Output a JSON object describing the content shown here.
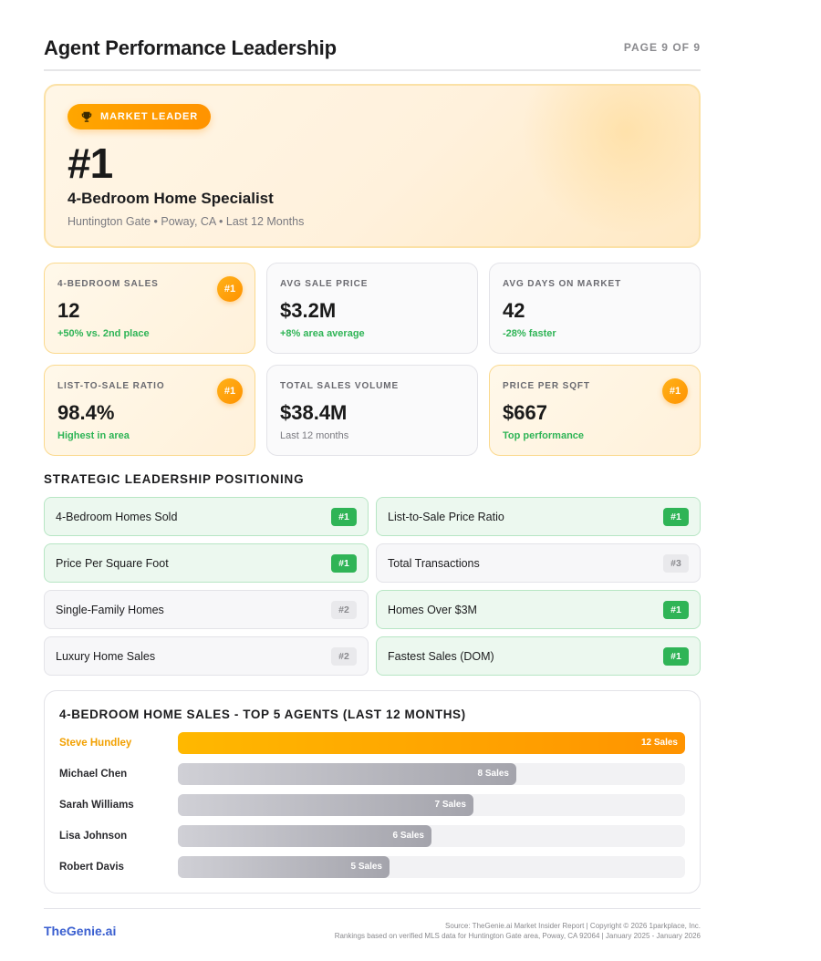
{
  "header": {
    "title": "Agent Performance Leadership",
    "page_label": "PAGE 9 OF 9"
  },
  "hero": {
    "badge_label": "MARKET LEADER",
    "badge_icon": "trophy-icon",
    "rank": "#1",
    "specialty": "4-Bedroom Home Specialist",
    "location": "Huntington Gate • Poway, CA • Last 12 Months"
  },
  "stats": [
    {
      "label": "4-BEDROOM SALES",
      "value": "12",
      "sub": "+50% vs. 2nd place",
      "badge": "#1"
    },
    {
      "label": "AVG SALE PRICE",
      "value": "$3.2M",
      "sub": "+8% area average",
      "badge": ""
    },
    {
      "label": "AVG DAYS ON MARKET",
      "value": "42",
      "sub": "-28% faster",
      "badge": ""
    },
    {
      "label": "LIST-TO-SALE RATIO",
      "value": "98.4%",
      "sub": "Highest in area",
      "badge": "#1"
    },
    {
      "label": "TOTAL SALES VOLUME",
      "value": "$38.4M",
      "sub": "Last 12 months",
      "badge": ""
    },
    {
      "label": "PRICE PER SQFT",
      "value": "$667",
      "sub": "Top performance",
      "badge": "#1"
    }
  ],
  "strategic": {
    "title": "STRATEGIC LEADERSHIP POSITIONING",
    "items": [
      {
        "label": "4-Bedroom Homes Sold",
        "rank": "#1"
      },
      {
        "label": "List-to-Sale Price Ratio",
        "rank": "#1"
      },
      {
        "label": "Price Per Square Foot",
        "rank": "#1"
      },
      {
        "label": "Total Transactions",
        "rank": "#3"
      },
      {
        "label": "Single-Family Homes",
        "rank": "#2"
      },
      {
        "label": "Homes Over $3M",
        "rank": "#1"
      },
      {
        "label": "Luxury Home Sales",
        "rank": "#2"
      },
      {
        "label": "Fastest Sales (DOM)",
        "rank": "#1"
      }
    ]
  },
  "chart_data": {
    "type": "bar",
    "title": "4-BEDROOM HOME SALES - TOP 5 AGENTS (LAST 12 MONTHS)",
    "categories": [
      "Steve Hundley",
      "Michael Chen",
      "Sarah Williams",
      "Lisa Johnson",
      "Robert Davis"
    ],
    "values": [
      12,
      8,
      7,
      6,
      5
    ],
    "value_labels": [
      "12 Sales",
      "8 Sales",
      "7 Sales",
      "6 Sales",
      "5 Sales"
    ],
    "xlim": [
      0,
      12
    ],
    "highlight_color": "#ffa600",
    "bar_color": "#a4a4ac"
  },
  "footer": {
    "brand": "TheGenie.ai",
    "source_line1": "Source: TheGenie.ai Market Insider Report | Copyright © 2026 1parkplace, Inc.",
    "source_line2": "Rankings based on verified MLS data for Huntington Gate area, Poway, CA 92064 | January 2025 - January 2026"
  }
}
